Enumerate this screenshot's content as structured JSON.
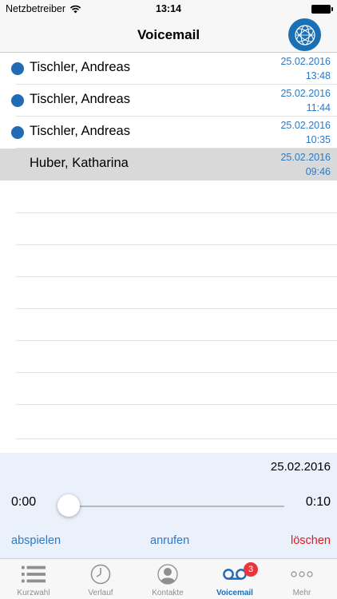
{
  "status_bar": {
    "carrier": "Netzbetreiber",
    "time": "13:14"
  },
  "nav": {
    "title": "Voicemail",
    "logo_icon": "globe-logo-icon"
  },
  "voicemails": [
    {
      "caller": "Tischler, Andreas",
      "date": "25.02.2016",
      "time": "13:48",
      "unread": true,
      "selected": false
    },
    {
      "caller": "Tischler, Andreas",
      "date": "25.02.2016",
      "time": "11:44",
      "unread": true,
      "selected": false
    },
    {
      "caller": "Tischler, Andreas",
      "date": "25.02.2016",
      "time": "10:35",
      "unread": true,
      "selected": false
    },
    {
      "caller": "Huber, Katharina",
      "date": "25.02.2016",
      "time": "09:46",
      "unread": false,
      "selected": true
    }
  ],
  "player": {
    "date": "25.02.2016",
    "elapsed": "0:00",
    "duration": "0:10",
    "progress": 0,
    "play_label": "abspielen",
    "call_label": "anrufen",
    "delete_label": "löschen"
  },
  "tabs": [
    {
      "label": "Kurzwahl",
      "icon": "list-icon",
      "active": false
    },
    {
      "label": "Verlauf",
      "icon": "clock-icon",
      "active": false
    },
    {
      "label": "Kontakte",
      "icon": "contact-icon",
      "active": false
    },
    {
      "label": "Voicemail",
      "icon": "voicemail-icon",
      "active": true
    },
    {
      "label": "Mehr",
      "icon": "more-icon",
      "active": false
    }
  ],
  "voicemail_badge": "3",
  "colors": {
    "accent": "#1f6cb4",
    "date_text": "#2f79c0",
    "delete": "#e0191e",
    "badge": "#e8363d",
    "player_bg": "#eaf1fa",
    "selected_row": "#d9d9d9"
  }
}
